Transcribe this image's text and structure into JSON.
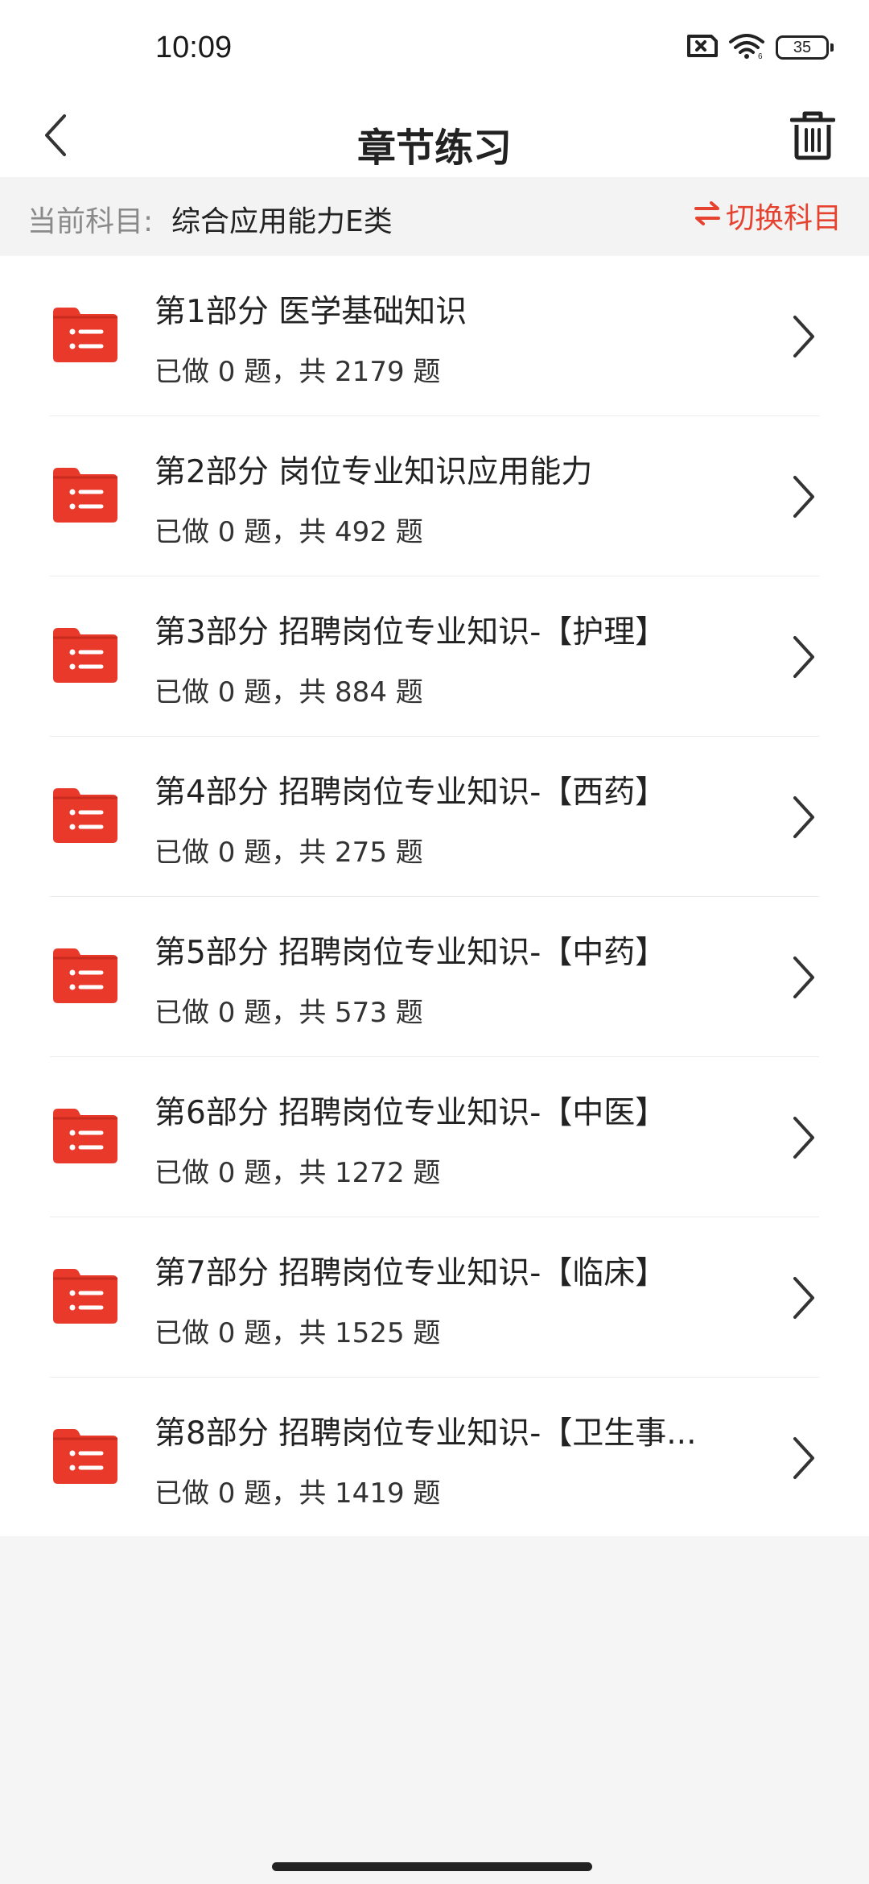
{
  "status_bar": {
    "time": "10:09",
    "battery": "35"
  },
  "nav": {
    "title": "章节练习"
  },
  "subject": {
    "label": "当前科目:",
    "value": "综合应用能力E类",
    "switch_label": "切换科目"
  },
  "chapters": [
    {
      "title": "第1部分 医学基础知识",
      "progress": "已做 0 题，共 2179 题"
    },
    {
      "title": "第2部分 岗位专业知识应用能力",
      "progress": "已做 0 题，共 492 题"
    },
    {
      "title": "第3部分 招聘岗位专业知识-【护理】",
      "progress": "已做 0 题，共 884 题"
    },
    {
      "title": "第4部分 招聘岗位专业知识-【西药】",
      "progress": "已做 0 题，共 275 题"
    },
    {
      "title": "第5部分 招聘岗位专业知识-【中药】",
      "progress": "已做 0 题，共 573 题"
    },
    {
      "title": "第6部分 招聘岗位专业知识-【中医】",
      "progress": "已做 0 题，共 1272 题"
    },
    {
      "title": "第7部分 招聘岗位专业知识-【临床】",
      "progress": "已做 0 题，共 1525 题"
    },
    {
      "title": "第8部分 招聘岗位专业知识-【卫生事...",
      "progress": "已做 0 题，共 1419 题"
    }
  ],
  "colors": {
    "accent": "#e5432f",
    "folder": "#e8392b"
  },
  "icons": {
    "back": "chevron-left-icon",
    "trash": "trash-icon",
    "switch": "swap-arrows-icon",
    "folder": "folder-list-icon",
    "chevron": "chevron-right-icon"
  }
}
